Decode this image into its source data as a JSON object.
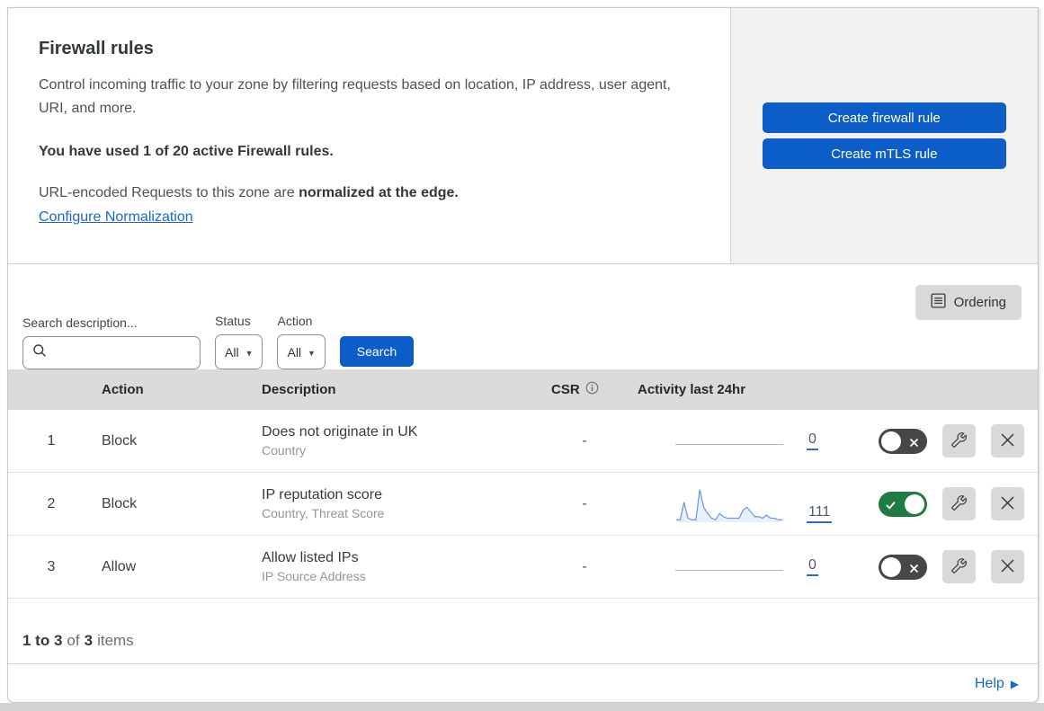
{
  "header": {
    "title": "Firewall rules",
    "description": "Control incoming traffic to your zone by filtering requests based on location, IP address, user agent, URI, and more.",
    "usage_bold": "You have used 1 of 20 active Firewall rules.",
    "normalization_prefix": "URL-encoded Requests to this zone are ",
    "normalization_bold": "normalized at the edge.",
    "normalization_link": "Configure Normalization"
  },
  "actions": {
    "create_firewall_rule": "Create firewall rule",
    "create_mtls_rule": "Create mTLS rule"
  },
  "filters": {
    "search_label": "Search description...",
    "search_placeholder": "",
    "status_label": "Status",
    "status_value": "All",
    "action_label": "Action",
    "action_value": "All",
    "search_button": "Search",
    "ordering_button": "Ordering"
  },
  "table": {
    "columns": {
      "action": "Action",
      "description": "Description",
      "csr": "CSR",
      "activity": "Activity last 24hr"
    },
    "rows": [
      {
        "priority": "1",
        "action": "Block",
        "description": "Does not originate in UK",
        "criteria": "Country",
        "csr": "-",
        "activity_count": "0",
        "enabled": false
      },
      {
        "priority": "2",
        "action": "Block",
        "description": "IP reputation score",
        "criteria": "Country, Threat Score",
        "csr": "-",
        "activity_count": "111",
        "enabled": true
      },
      {
        "priority": "3",
        "action": "Allow",
        "description": "Allow listed IPs",
        "criteria": "IP Source Address",
        "csr": "-",
        "activity_count": "0",
        "enabled": false
      }
    ]
  },
  "footer": {
    "range_bold": "1 to 3",
    "of_text": "of",
    "total_bold": "3",
    "items_text": "items",
    "help_link": "Help"
  },
  "colors": {
    "primary_button_blue": "#0d5dc8",
    "link_blue": "#2166cb",
    "toggle_on_green": "#1e7b41",
    "toggle_off_gray": "#474747",
    "sparkline_blue": "#6f9be0",
    "table_header_gray": "#dbdbdb",
    "side_panel_gray": "#f1f1f1",
    "control_button_gray": "#d9d9d9"
  },
  "chart_data": [
    {
      "type": "area",
      "name": "rule-1-activity-last-24hr",
      "total": 0,
      "values": [
        0,
        0,
        0,
        0,
        0,
        0,
        0,
        0,
        0,
        0,
        0,
        0,
        0,
        0,
        0,
        0,
        0,
        0,
        0,
        0,
        0,
        0,
        0,
        0,
        0,
        0,
        0,
        0
      ]
    },
    {
      "type": "area",
      "name": "rule-2-activity-last-24hr",
      "total": 111,
      "title": "Activity last 24hr (IP reputation score)",
      "values": [
        1,
        1,
        12,
        2,
        1,
        1,
        20,
        9,
        5,
        2,
        1,
        5,
        3,
        2,
        2,
        2,
        2,
        7,
        9,
        6,
        3,
        3,
        2,
        4,
        2,
        2,
        1,
        1
      ]
    },
    {
      "type": "area",
      "name": "rule-3-activity-last-24hr",
      "total": 0,
      "values": [
        0,
        0,
        0,
        0,
        0,
        0,
        0,
        0,
        0,
        0,
        0,
        0,
        0,
        0,
        0,
        0,
        0,
        0,
        0,
        0,
        0,
        0,
        0,
        0,
        0,
        0,
        0,
        0
      ]
    }
  ]
}
